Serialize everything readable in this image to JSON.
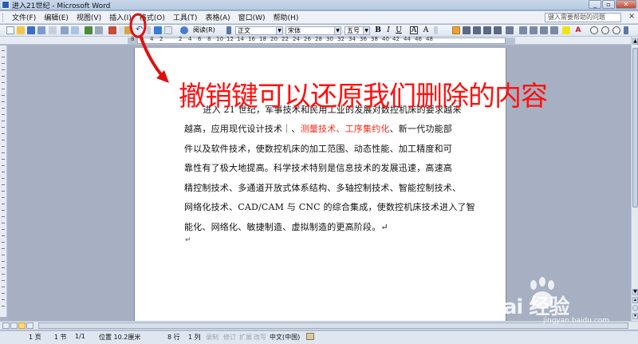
{
  "window": {
    "title": "进入21世纪 - Microsoft Word",
    "minimize": "_",
    "restore": "▫",
    "close": "✕"
  },
  "menubar": {
    "items": [
      "文件(F)",
      "编辑(E)",
      "视图(V)",
      "插入(I)",
      "格式(O)",
      "工具(T)",
      "表格(A)",
      "窗口(W)",
      "帮助(H)"
    ],
    "help_placeholder": "键入需要帮助的问题",
    "close_doc": "×"
  },
  "toolbar": {
    "reading_mode": "阅读(R)",
    "style": "正文",
    "font": "宋体",
    "size": "五号",
    "bold": "B",
    "italic": "I",
    "underline": "U",
    "char_border": "A",
    "char_scale": "A"
  },
  "ruler": {
    "numbers": [
      "8",
      "6",
      "4",
      "2",
      "2",
      "4",
      "6",
      "8",
      "10",
      "12",
      "14",
      "16",
      "18",
      "20",
      "22",
      "24",
      "26",
      "28",
      "30",
      "32",
      "34",
      "36",
      "38",
      "40",
      "42",
      "44",
      "46",
      "48"
    ]
  },
  "document": {
    "lines": [
      [
        {
          "t": "　　进入 21 世纪，军事技术和民用工业的发展对数控机床的要求越来",
          "c": ""
        }
      ],
      [
        {
          "t": "越高，应用现代设计技术｜、",
          "c": ""
        },
        {
          "t": "测量技术、工序集约化",
          "c": "red"
        },
        {
          "t": "、新一代功能部",
          "c": ""
        }
      ],
      [
        {
          "t": "件以及软件技术，使数控机床的加工范围、动态性能、加工精度和可",
          "c": ""
        }
      ],
      [
        {
          "t": "靠性有了极大地提高。科学技术特别是信息技术的发展迅速，高速高",
          "c": ""
        }
      ],
      [
        {
          "t": "精控制技术、多通道开放式体系结构、多轴控制技术、智能控制技术、",
          "c": ""
        }
      ],
      [
        {
          "t": "网络化技术、CAD/CAM 与 CNC 的综合集成，使数控机床技术进入了智",
          "c": ""
        }
      ],
      [
        {
          "t": "能化、网络化、敏捷制造、虚拟制造的更高阶段。↵",
          "c": ""
        }
      ]
    ],
    "empty_para": "↵"
  },
  "annotation": {
    "text": "撤销键可以还原我们删除的内容",
    "color": "#ff1010"
  },
  "statusbar": {
    "page": "1 页",
    "section": "1 节",
    "pages": "1/1",
    "position": "位置 10.2厘米",
    "line": "8 行",
    "column": "1 列",
    "rec": "录制",
    "trk": "修订",
    "ext": "扩展",
    "ovr": "改写",
    "lang": "中文(中国)"
  },
  "watermark": {
    "brand": "Bai 经验",
    "url": "jingyan.baidu.com"
  }
}
